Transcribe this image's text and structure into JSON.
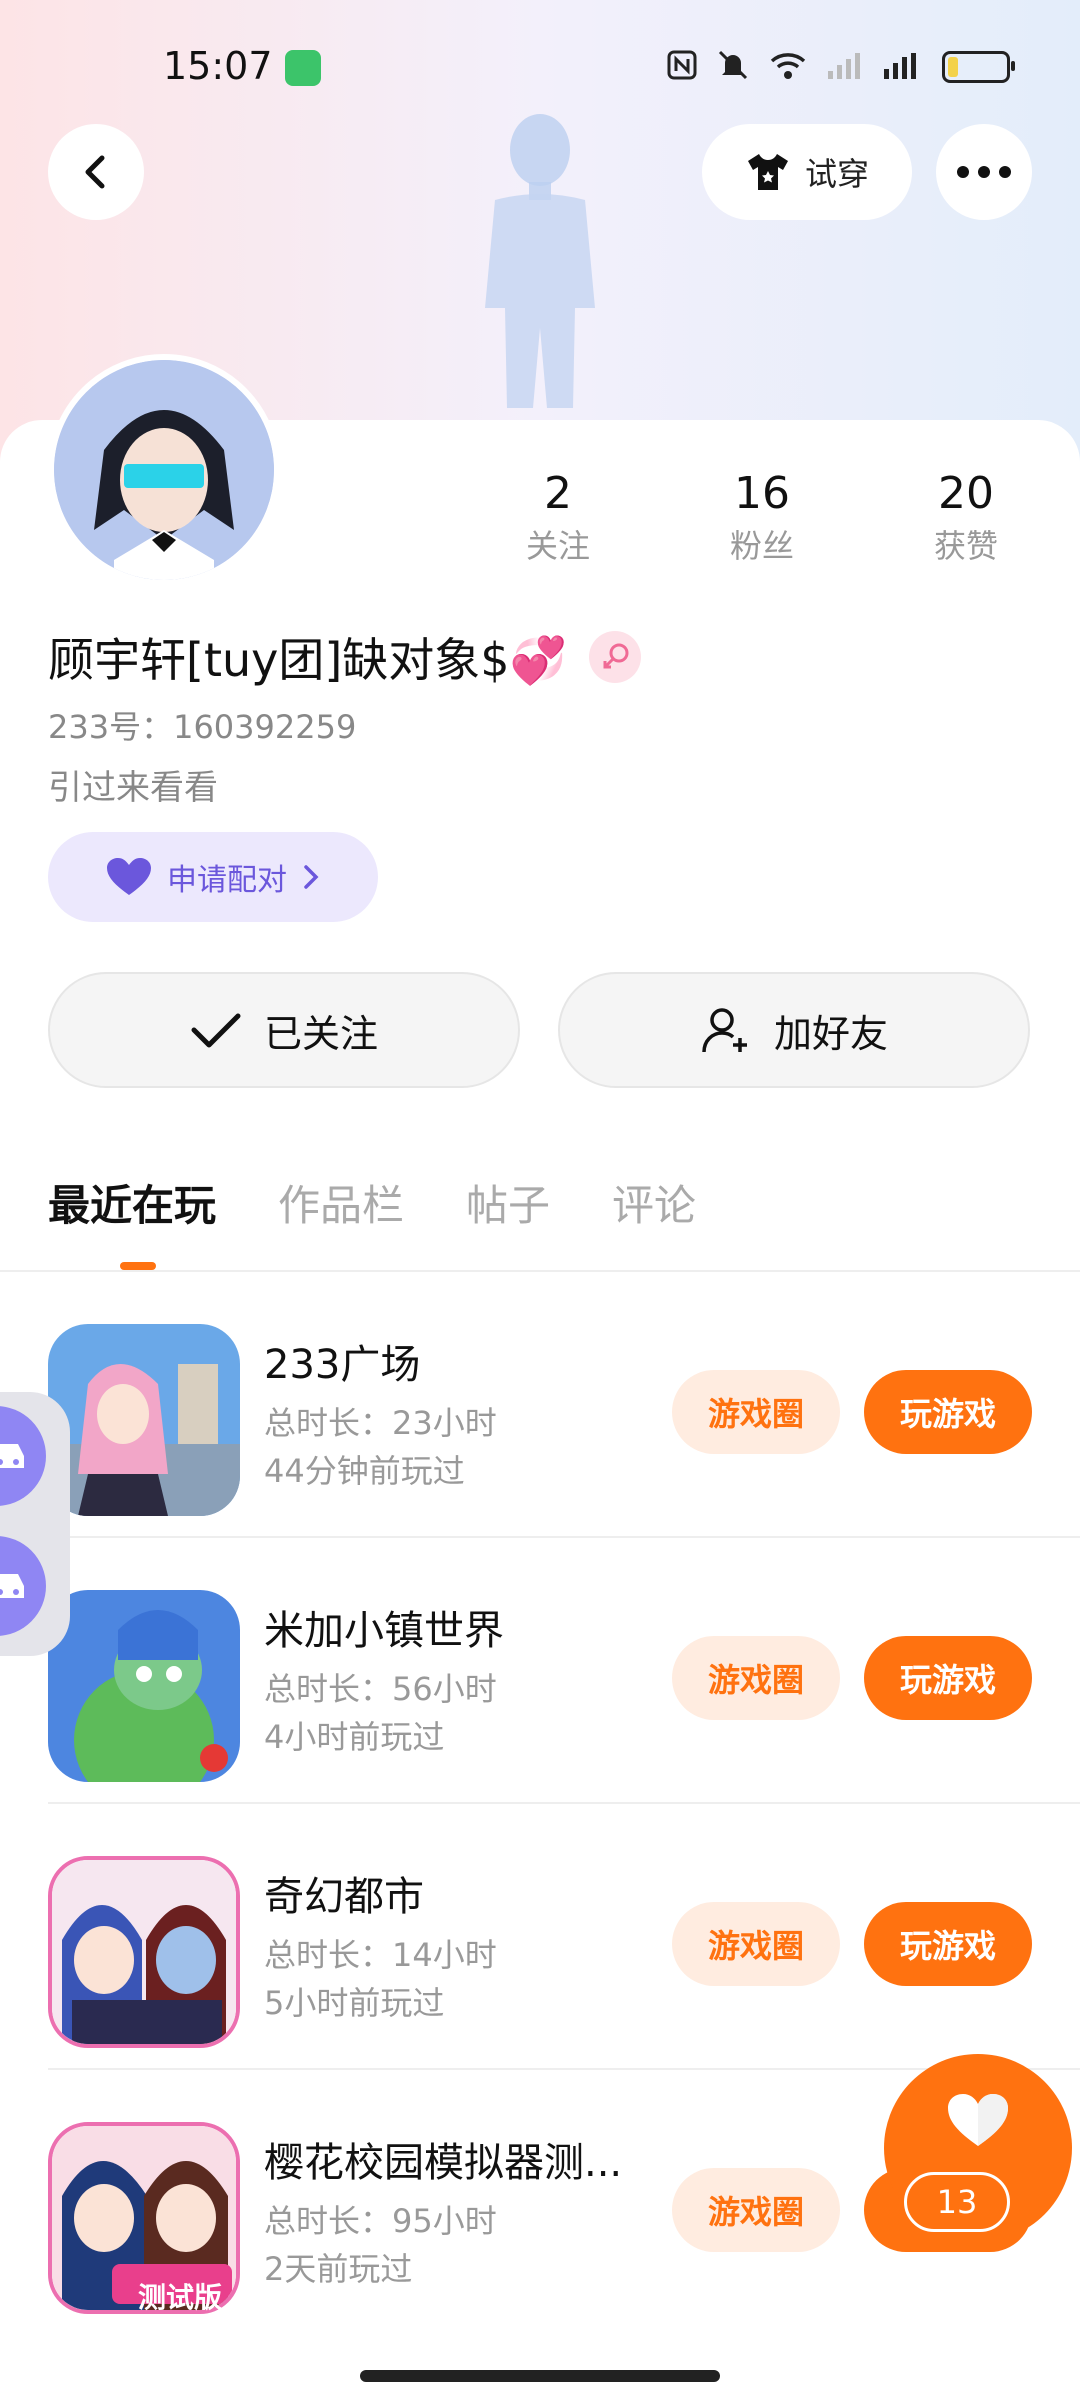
{
  "status_bar": {
    "time": "15:07"
  },
  "header": {
    "try_on_label": "试穿"
  },
  "profile": {
    "name": "顾宇轩[tuy团]缺对象$💞",
    "id_text": "233号：160392259",
    "bio": "引过来看看",
    "pair_label": "申请配对",
    "stats": [
      {
        "num": "2",
        "label": "关注"
      },
      {
        "num": "16",
        "label": "粉丝"
      },
      {
        "num": "20",
        "label": "获赞"
      }
    ],
    "followed_label": "已关注",
    "add_friend_label": "加好友"
  },
  "tabs": [
    "最近在玩",
    "作品栏",
    "帖子",
    "评论"
  ],
  "games": [
    {
      "title": "233广场",
      "duration": "总时长：23小时",
      "last_played": "44分钟前玩过",
      "circle_label": "游戏圈",
      "play_label": "玩游戏"
    },
    {
      "title": "米加小镇世界",
      "duration": "总时长：56小时",
      "last_played": "4小时前玩过",
      "circle_label": "游戏圈",
      "play_label": "玩游戏"
    },
    {
      "title": "奇幻都市",
      "duration": "总时长：14小时",
      "last_played": "5小时前玩过",
      "circle_label": "游戏圈",
      "play_label": "玩游戏"
    },
    {
      "title": "樱花校园模拟器测...",
      "duration": "总时长：95小时",
      "last_played": "2天前玩过",
      "circle_label": "游戏圈",
      "play_label": "玩"
    }
  ],
  "games_extra": {
    "icon3_badge": "测试版"
  },
  "like_fab": {
    "count": "13"
  },
  "colors": {
    "accent": "#ff7210",
    "pair_purple": "#6b57dc",
    "float_purple": "#8f86f3"
  }
}
